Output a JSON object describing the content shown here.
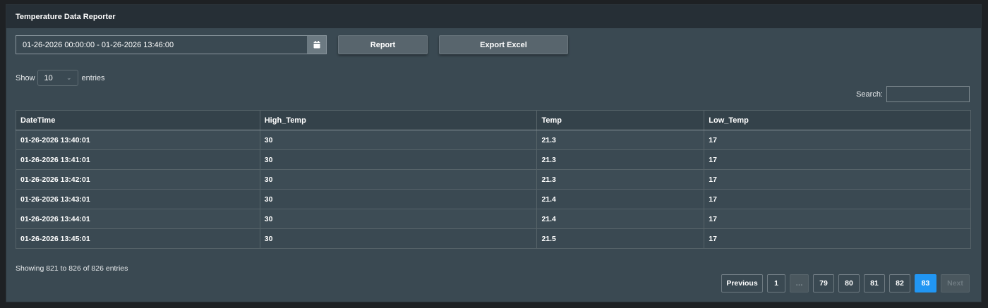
{
  "app": {
    "title": "Temperature Data Reporter"
  },
  "toolbar": {
    "date_range": "01-26-2026 00:00:00 - 01-26-2026 13:46:00",
    "calendar_icon": "calendar-icon",
    "report_label": "Report",
    "export_label": "Export Excel"
  },
  "length": {
    "show_label": "Show",
    "selected": "10",
    "entries_label": "entries"
  },
  "search": {
    "label": "Search:",
    "value": ""
  },
  "table": {
    "columns": [
      "DateTime",
      "High_Temp",
      "Temp",
      "Low_Temp"
    ],
    "rows": [
      [
        "01-26-2026 13:40:01",
        "30",
        "21.3",
        "17"
      ],
      [
        "01-26-2026 13:41:01",
        "30",
        "21.3",
        "17"
      ],
      [
        "01-26-2026 13:42:01",
        "30",
        "21.3",
        "17"
      ],
      [
        "01-26-2026 13:43:01",
        "30",
        "21.4",
        "17"
      ],
      [
        "01-26-2026 13:44:01",
        "30",
        "21.4",
        "17"
      ],
      [
        "01-26-2026 13:45:01",
        "30",
        "21.5",
        "17"
      ]
    ]
  },
  "info": "Showing 821 to 826 of 826 entries",
  "pagination": {
    "previous": "Previous",
    "pages": [
      "1",
      "…",
      "79",
      "80",
      "81",
      "82",
      "83"
    ],
    "active": "83",
    "next": "Next"
  },
  "colors": {
    "active_page": "#2196f3",
    "panel_bg": "#3a4952",
    "header_bg": "#262f36"
  }
}
